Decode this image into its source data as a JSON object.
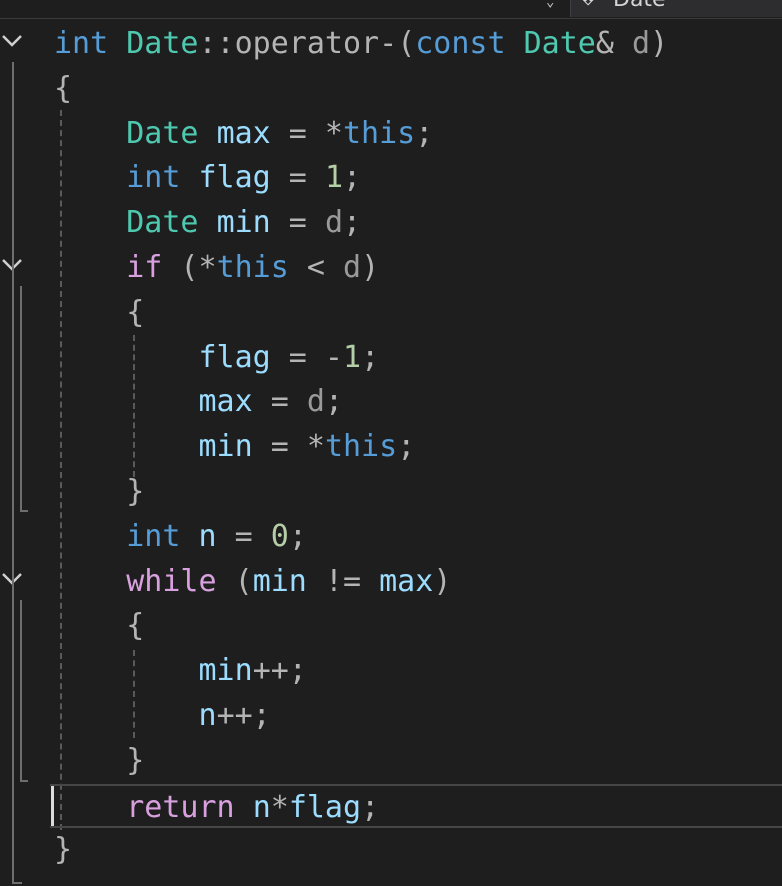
{
  "editor": {
    "member_dropdown": {
      "icon": "member-icon",
      "label": "Date"
    },
    "lines": [
      {
        "tokens": [
          {
            "t": "int",
            "c": "kw"
          },
          {
            "t": " ",
            "c": ""
          },
          {
            "t": "Date",
            "c": "type"
          },
          {
            "t": "::operator-",
            "c": "op"
          },
          {
            "t": "(",
            "c": "op"
          },
          {
            "t": "const",
            "c": "kw"
          },
          {
            "t": " ",
            "c": ""
          },
          {
            "t": "Date",
            "c": "type"
          },
          {
            "t": "& ",
            "c": "op"
          },
          {
            "t": "d",
            "c": "param"
          },
          {
            "t": ")",
            "c": "op"
          }
        ]
      },
      {
        "tokens": [
          {
            "t": "{",
            "c": "op"
          }
        ]
      },
      {
        "tokens": [
          {
            "t": "    ",
            "c": ""
          },
          {
            "t": "Date",
            "c": "type"
          },
          {
            "t": " ",
            "c": ""
          },
          {
            "t": "max",
            "c": "var"
          },
          {
            "t": " = *",
            "c": "op"
          },
          {
            "t": "this",
            "c": "kw"
          },
          {
            "t": ";",
            "c": "op"
          }
        ]
      },
      {
        "tokens": [
          {
            "t": "    ",
            "c": ""
          },
          {
            "t": "int",
            "c": "kw"
          },
          {
            "t": " ",
            "c": ""
          },
          {
            "t": "flag",
            "c": "var"
          },
          {
            "t": " = ",
            "c": "op"
          },
          {
            "t": "1",
            "c": "num"
          },
          {
            "t": ";",
            "c": "op"
          }
        ]
      },
      {
        "tokens": [
          {
            "t": "    ",
            "c": ""
          },
          {
            "t": "Date",
            "c": "type"
          },
          {
            "t": " ",
            "c": ""
          },
          {
            "t": "min",
            "c": "var"
          },
          {
            "t": " = ",
            "c": "op"
          },
          {
            "t": "d",
            "c": "param"
          },
          {
            "t": ";",
            "c": "op"
          }
        ]
      },
      {
        "tokens": [
          {
            "t": "    ",
            "c": ""
          },
          {
            "t": "if",
            "c": "ctl"
          },
          {
            "t": " (*",
            "c": "op"
          },
          {
            "t": "this",
            "c": "kw"
          },
          {
            "t": " < ",
            "c": "op"
          },
          {
            "t": "d",
            "c": "param"
          },
          {
            "t": ")",
            "c": "op"
          }
        ]
      },
      {
        "tokens": [
          {
            "t": "    ",
            "c": ""
          },
          {
            "t": "{",
            "c": "op"
          }
        ]
      },
      {
        "tokens": [
          {
            "t": "        ",
            "c": ""
          },
          {
            "t": "flag",
            "c": "var"
          },
          {
            "t": " = -",
            "c": "op"
          },
          {
            "t": "1",
            "c": "num"
          },
          {
            "t": ";",
            "c": "op"
          }
        ]
      },
      {
        "tokens": [
          {
            "t": "        ",
            "c": ""
          },
          {
            "t": "max",
            "c": "var"
          },
          {
            "t": " = ",
            "c": "op"
          },
          {
            "t": "d",
            "c": "param"
          },
          {
            "t": ";",
            "c": "op"
          }
        ]
      },
      {
        "tokens": [
          {
            "t": "        ",
            "c": ""
          },
          {
            "t": "min",
            "c": "var"
          },
          {
            "t": " = *",
            "c": "op"
          },
          {
            "t": "this",
            "c": "kw"
          },
          {
            "t": ";",
            "c": "op"
          }
        ]
      },
      {
        "tokens": [
          {
            "t": "    ",
            "c": ""
          },
          {
            "t": "}",
            "c": "op"
          }
        ]
      },
      {
        "tokens": [
          {
            "t": "    ",
            "c": ""
          },
          {
            "t": "int",
            "c": "kw"
          },
          {
            "t": " ",
            "c": ""
          },
          {
            "t": "n",
            "c": "var"
          },
          {
            "t": " = ",
            "c": "op"
          },
          {
            "t": "0",
            "c": "num"
          },
          {
            "t": ";",
            "c": "op"
          }
        ]
      },
      {
        "tokens": [
          {
            "t": "    ",
            "c": ""
          },
          {
            "t": "while",
            "c": "ctl"
          },
          {
            "t": " (",
            "c": "op"
          },
          {
            "t": "min",
            "c": "var"
          },
          {
            "t": " != ",
            "c": "op"
          },
          {
            "t": "max",
            "c": "var"
          },
          {
            "t": ")",
            "c": "op"
          }
        ]
      },
      {
        "tokens": [
          {
            "t": "    ",
            "c": ""
          },
          {
            "t": "{",
            "c": "op"
          }
        ]
      },
      {
        "tokens": [
          {
            "t": "        ",
            "c": ""
          },
          {
            "t": "min",
            "c": "var"
          },
          {
            "t": "++;",
            "c": "op"
          }
        ]
      },
      {
        "tokens": [
          {
            "t": "        ",
            "c": ""
          },
          {
            "t": "n",
            "c": "var"
          },
          {
            "t": "++;",
            "c": "op"
          }
        ]
      },
      {
        "tokens": [
          {
            "t": "    ",
            "c": ""
          },
          {
            "t": "}",
            "c": "op"
          }
        ]
      },
      {
        "tokens": [
          {
            "t": "    ",
            "c": ""
          },
          {
            "t": "return",
            "c": "ctl"
          },
          {
            "t": " ",
            "c": ""
          },
          {
            "t": "n",
            "c": "var"
          },
          {
            "t": "*",
            "c": "op"
          },
          {
            "t": "flag",
            "c": "var"
          },
          {
            "t": ";",
            "c": "op"
          }
        ]
      },
      {
        "tokens": [
          {
            "t": "}",
            "c": "op"
          }
        ]
      }
    ],
    "current_line": 17,
    "fold_lines": [
      0,
      5,
      12
    ]
  }
}
